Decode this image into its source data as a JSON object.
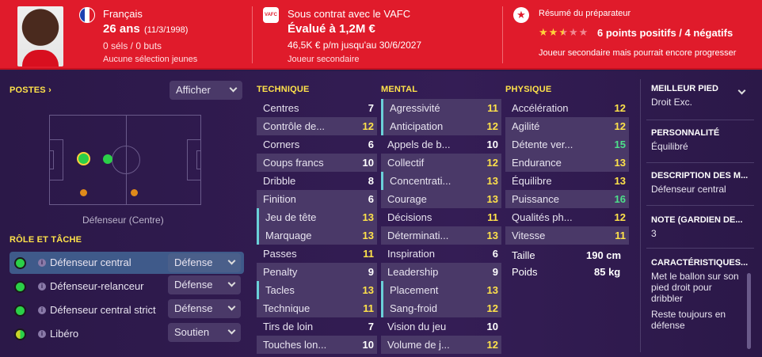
{
  "header": {
    "nationality": "Français",
    "age": "26 ans",
    "birth": "(11/3/1998)",
    "caps": "0 séls / 0 buts",
    "youth": "Aucune sélection jeunes",
    "contract_title": "Sous contrat avec le VAFC",
    "club_badge": "VAFC",
    "value": "Évalué à 1,2M €",
    "wage": "46,5K € p/m jusqu'au 30/6/2027",
    "status": "Joueur secondaire",
    "coach_title": "Résumé du préparateur",
    "stars": 2.5,
    "points": "6 points positifs / 4 négatifs",
    "coach_note": "Joueur secondaire mais pourrait encore progresser"
  },
  "positions": {
    "label": "POSTES",
    "show_button": "Afficher",
    "position_name": "Défenseur (Centre)"
  },
  "roles": {
    "label": "RÔLE ET TÂCHE",
    "items": [
      {
        "name": "Défenseur central",
        "duty": "Défense"
      },
      {
        "name": "Défenseur-relanceur",
        "duty": "Défense"
      },
      {
        "name": "Défenseur central strict",
        "duty": "Défense"
      },
      {
        "name": "Libéro",
        "duty": "Soutien"
      }
    ]
  },
  "technique": {
    "label": "TECHNIQUE",
    "items": [
      {
        "n": "Centres",
        "v": "7"
      },
      {
        "n": "Contrôle de...",
        "v": "12"
      },
      {
        "n": "Corners",
        "v": "6"
      },
      {
        "n": "Coups francs",
        "v": "10"
      },
      {
        "n": "Dribble",
        "v": "8"
      },
      {
        "n": "Finition",
        "v": "6"
      },
      {
        "n": "Jeu de tête",
        "v": "13"
      },
      {
        "n": "Marquage",
        "v": "13"
      },
      {
        "n": "Passes",
        "v": "11"
      },
      {
        "n": "Penalty",
        "v": "9"
      },
      {
        "n": "Tacles",
        "v": "13"
      },
      {
        "n": "Technique",
        "v": "11"
      },
      {
        "n": "Tirs de loin",
        "v": "7"
      },
      {
        "n": "Touches lon...",
        "v": "10"
      }
    ]
  },
  "mental": {
    "label": "MENTAL",
    "items": [
      {
        "n": "Agressivité",
        "v": "11"
      },
      {
        "n": "Anticipation",
        "v": "12"
      },
      {
        "n": "Appels de b...",
        "v": "10"
      },
      {
        "n": "Collectif",
        "v": "12"
      },
      {
        "n": "Concentrati...",
        "v": "13"
      },
      {
        "n": "Courage",
        "v": "13"
      },
      {
        "n": "Décisions",
        "v": "11"
      },
      {
        "n": "Déterminati...",
        "v": "13"
      },
      {
        "n": "Inspiration",
        "v": "6"
      },
      {
        "n": "Leadership",
        "v": "9"
      },
      {
        "n": "Placement",
        "v": "13"
      },
      {
        "n": "Sang-froid",
        "v": "12"
      },
      {
        "n": "Vision du jeu",
        "v": "10"
      },
      {
        "n": "Volume de j...",
        "v": "12"
      }
    ]
  },
  "physique": {
    "label": "PHYSIQUE",
    "items": [
      {
        "n": "Accélération",
        "v": "12"
      },
      {
        "n": "Agilité",
        "v": "12"
      },
      {
        "n": "Détente ver...",
        "v": "15"
      },
      {
        "n": "Endurance",
        "v": "13"
      },
      {
        "n": "Équilibre",
        "v": "13"
      },
      {
        "n": "Puissance",
        "v": "16"
      },
      {
        "n": "Qualités ph...",
        "v": "12"
      },
      {
        "n": "Vitesse",
        "v": "11"
      }
    ],
    "height_label": "Taille",
    "height": "190 cm",
    "weight_label": "Poids",
    "weight": "85 kg"
  },
  "right": {
    "foot_h": "MEILLEUR PIED",
    "foot": "Droit Exc.",
    "pers_h": "PERSONNALITÉ",
    "pers": "Équilibré",
    "desc_h": "DESCRIPTION DES M...",
    "desc": "Défenseur central",
    "note_h": "NOTE (GARDIEN DE...",
    "note": "3",
    "car_h": "CARACTÉRISTIQUES...",
    "car1": "Met le ballon sur son pied droit pour dribbler",
    "car2": "Reste toujours en défense"
  }
}
